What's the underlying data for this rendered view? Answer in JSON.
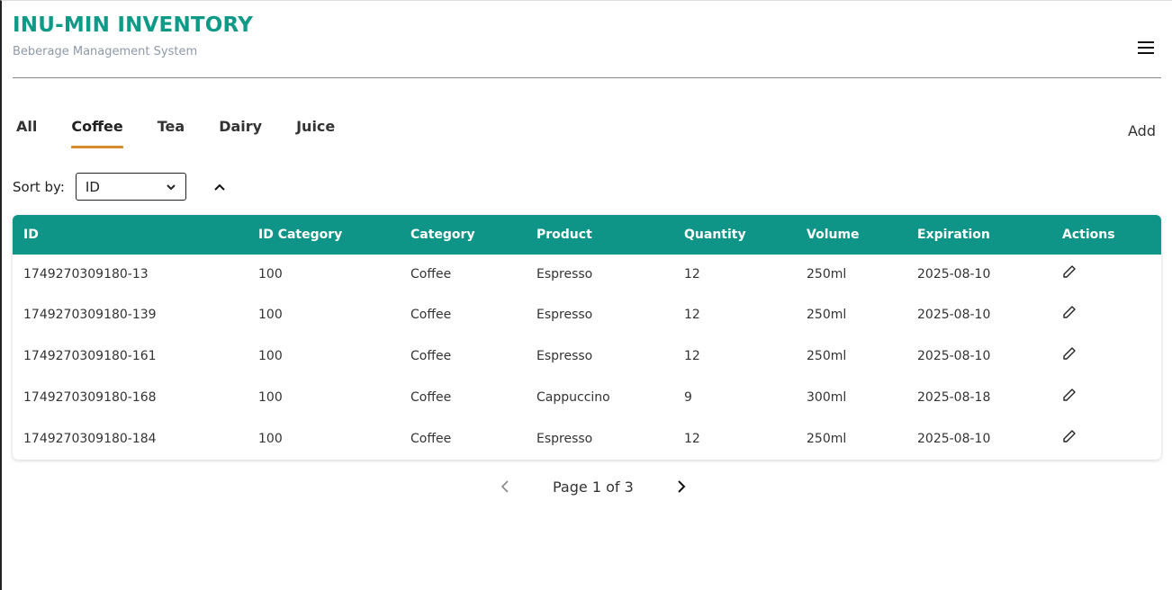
{
  "header": {
    "title": "INU-MIN INVENTORY",
    "subtitle": "Beberage Management System"
  },
  "tabs": [
    {
      "label": "All",
      "active": false
    },
    {
      "label": "Coffee",
      "active": true
    },
    {
      "label": "Tea",
      "active": false
    },
    {
      "label": "Dairy",
      "active": false
    },
    {
      "label": "Juice",
      "active": false
    }
  ],
  "add_label": "Add",
  "sort": {
    "label": "Sort by:",
    "selected": "ID",
    "direction": "ascending"
  },
  "table": {
    "columns": [
      "ID",
      "ID Category",
      "Category",
      "Product",
      "Quantity",
      "Volume",
      "Expiration",
      "Actions"
    ],
    "rows": [
      [
        "1749270309180-13",
        "100",
        "Coffee",
        "Espresso",
        "12",
        "250ml",
        "2025-08-10"
      ],
      [
        "1749270309180-139",
        "100",
        "Coffee",
        "Espresso",
        "12",
        "250ml",
        "2025-08-10"
      ],
      [
        "1749270309180-161",
        "100",
        "Coffee",
        "Espresso",
        "12",
        "250ml",
        "2025-08-10"
      ],
      [
        "1749270309180-168",
        "100",
        "Coffee",
        "Cappuccino",
        "9",
        "300ml",
        "2025-08-18"
      ],
      [
        "1749270309180-184",
        "100",
        "Coffee",
        "Espresso",
        "12",
        "250ml",
        "2025-08-10"
      ]
    ]
  },
  "pagination": {
    "text": "Page 1 of 3"
  },
  "colors": {
    "brand": "#0f9a88",
    "table_header": "#0f9488",
    "active_tab_underline": "#d98a2b"
  }
}
